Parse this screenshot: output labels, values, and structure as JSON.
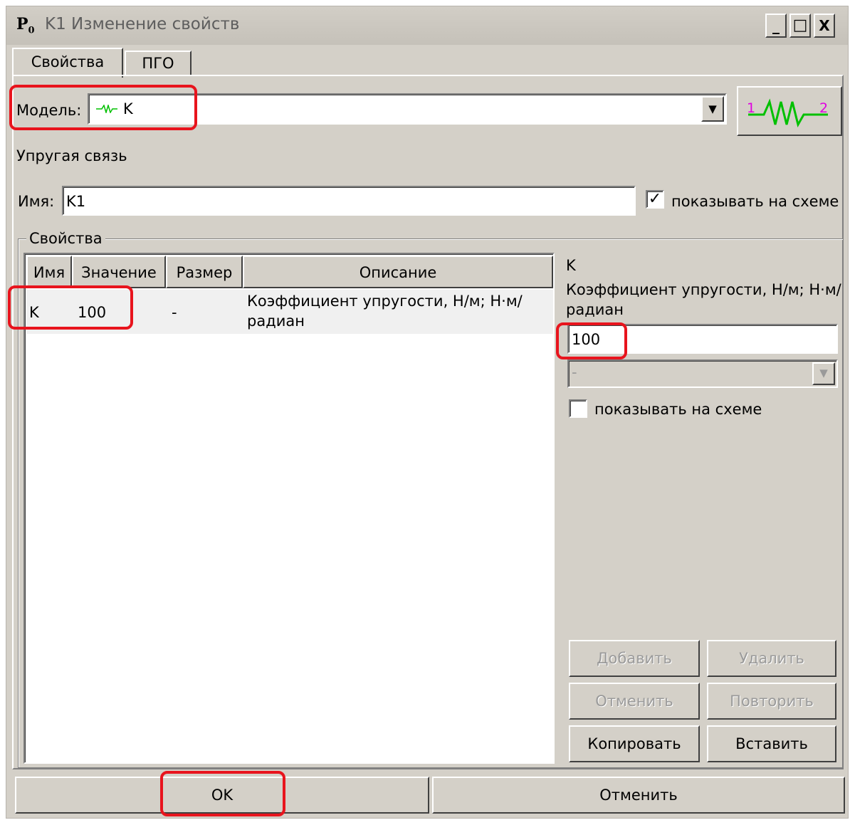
{
  "window": {
    "app_icon": "P",
    "app_icon_sub": "0",
    "title": "K1 Изменение свойств",
    "controls": {
      "minimize": "_",
      "maximize": "□",
      "close": "X"
    }
  },
  "tabs": [
    {
      "label": "Свойства",
      "active": true
    },
    {
      "label": "ПГО",
      "active": false
    }
  ],
  "model": {
    "label": "Модель:",
    "value": "K",
    "icon": "spring-icon",
    "preview_left": "1",
    "preview_right": "2"
  },
  "model_description": "Упругая связь",
  "name_field": {
    "label": "Имя:",
    "value": "K1",
    "show_on_schema_label": "показывать на схеме",
    "show_on_schema_checked": true
  },
  "properties": {
    "group_title": "Свойства",
    "columns": [
      "Имя",
      "Значение",
      "Размер",
      "Описание"
    ],
    "rows": [
      {
        "name": "K",
        "value": "100",
        "size": "-",
        "description_line1": "Коэффициент  упругости, Н/м; Н·м/",
        "description_line2": "радиан"
      }
    ]
  },
  "detail": {
    "name": "K",
    "description_line1": "Коэффициент  упругости, Н/м; Н·м/",
    "description_line2": "радиан",
    "value": "100",
    "unit_select": "-",
    "show_on_schema_label": "показывать на схеме",
    "show_on_schema_checked": false
  },
  "buttons": {
    "add": "Добавить",
    "delete": "Удалить",
    "undo": "Отменить",
    "redo": "Повторить",
    "copy": "Копировать",
    "paste": "Вставить",
    "ok": "OK",
    "cancel": "Отменить"
  },
  "colors": {
    "highlight": "#e8141d",
    "spring_green": "#00c000",
    "spring_label": "#e000e0"
  }
}
